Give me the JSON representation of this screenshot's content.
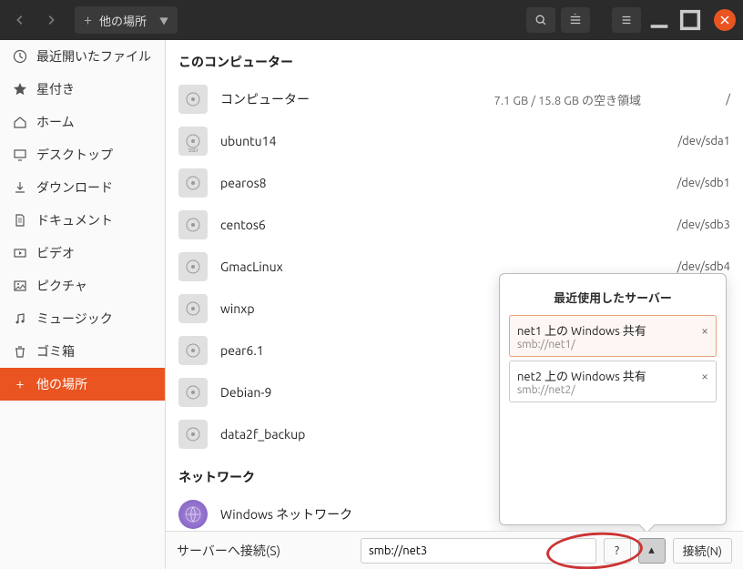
{
  "titlebar": {
    "path_label": "他の場所"
  },
  "sidebar": {
    "items": [
      {
        "icon": "clock",
        "label": "最近開いたファイル"
      },
      {
        "icon": "star",
        "label": "星付き"
      },
      {
        "icon": "home",
        "label": "ホーム"
      },
      {
        "icon": "desktop",
        "label": "デスクトップ"
      },
      {
        "icon": "download",
        "label": "ダウンロード"
      },
      {
        "icon": "document",
        "label": "ドキュメント"
      },
      {
        "icon": "video",
        "label": "ビデオ"
      },
      {
        "icon": "picture",
        "label": "ピクチャ"
      },
      {
        "icon": "music",
        "label": "ミュージック"
      },
      {
        "icon": "trash",
        "label": "ゴミ箱"
      },
      {
        "icon": "plus",
        "label": "他の場所",
        "active": true
      }
    ]
  },
  "sections": {
    "computer": "このコンピューター",
    "network": "ネットワーク"
  },
  "rows": [
    {
      "name": "コンピューター",
      "sub1": "7.1 GB / 15.8 GB の空き領域",
      "sub2": "/"
    },
    {
      "name": "ubuntu14",
      "sub1": "",
      "sub2": "/dev/sda1",
      "ssd": true
    },
    {
      "name": "pearos8",
      "sub1": "",
      "sub2": "/dev/sdb1"
    },
    {
      "name": "centos6",
      "sub1": "",
      "sub2": "/dev/sdb3"
    },
    {
      "name": "GmacLinux",
      "sub1": "",
      "sub2": "/dev/sdb4"
    },
    {
      "name": "winxp",
      "sub1": "",
      "sub2": ""
    },
    {
      "name": "pear6.1",
      "sub1": "",
      "sub2": ""
    },
    {
      "name": "Debian-9",
      "sub1": "",
      "sub2": ""
    },
    {
      "name": "data2f_backup",
      "sub1": "",
      "sub2": ""
    }
  ],
  "network_row": {
    "name": "Windows ネットワーク"
  },
  "footer": {
    "label": "サーバーへ接続(S)",
    "input_value": "smb://net3",
    "connect": "接続(N)"
  },
  "popup": {
    "title": "最近使用したサーバー",
    "items": [
      {
        "title": "net1 上の Windows 共有",
        "uri": "smb://net1/",
        "selected": true
      },
      {
        "title": "net2 上の Windows 共有",
        "uri": "smb://net2/",
        "selected": false
      }
    ]
  }
}
